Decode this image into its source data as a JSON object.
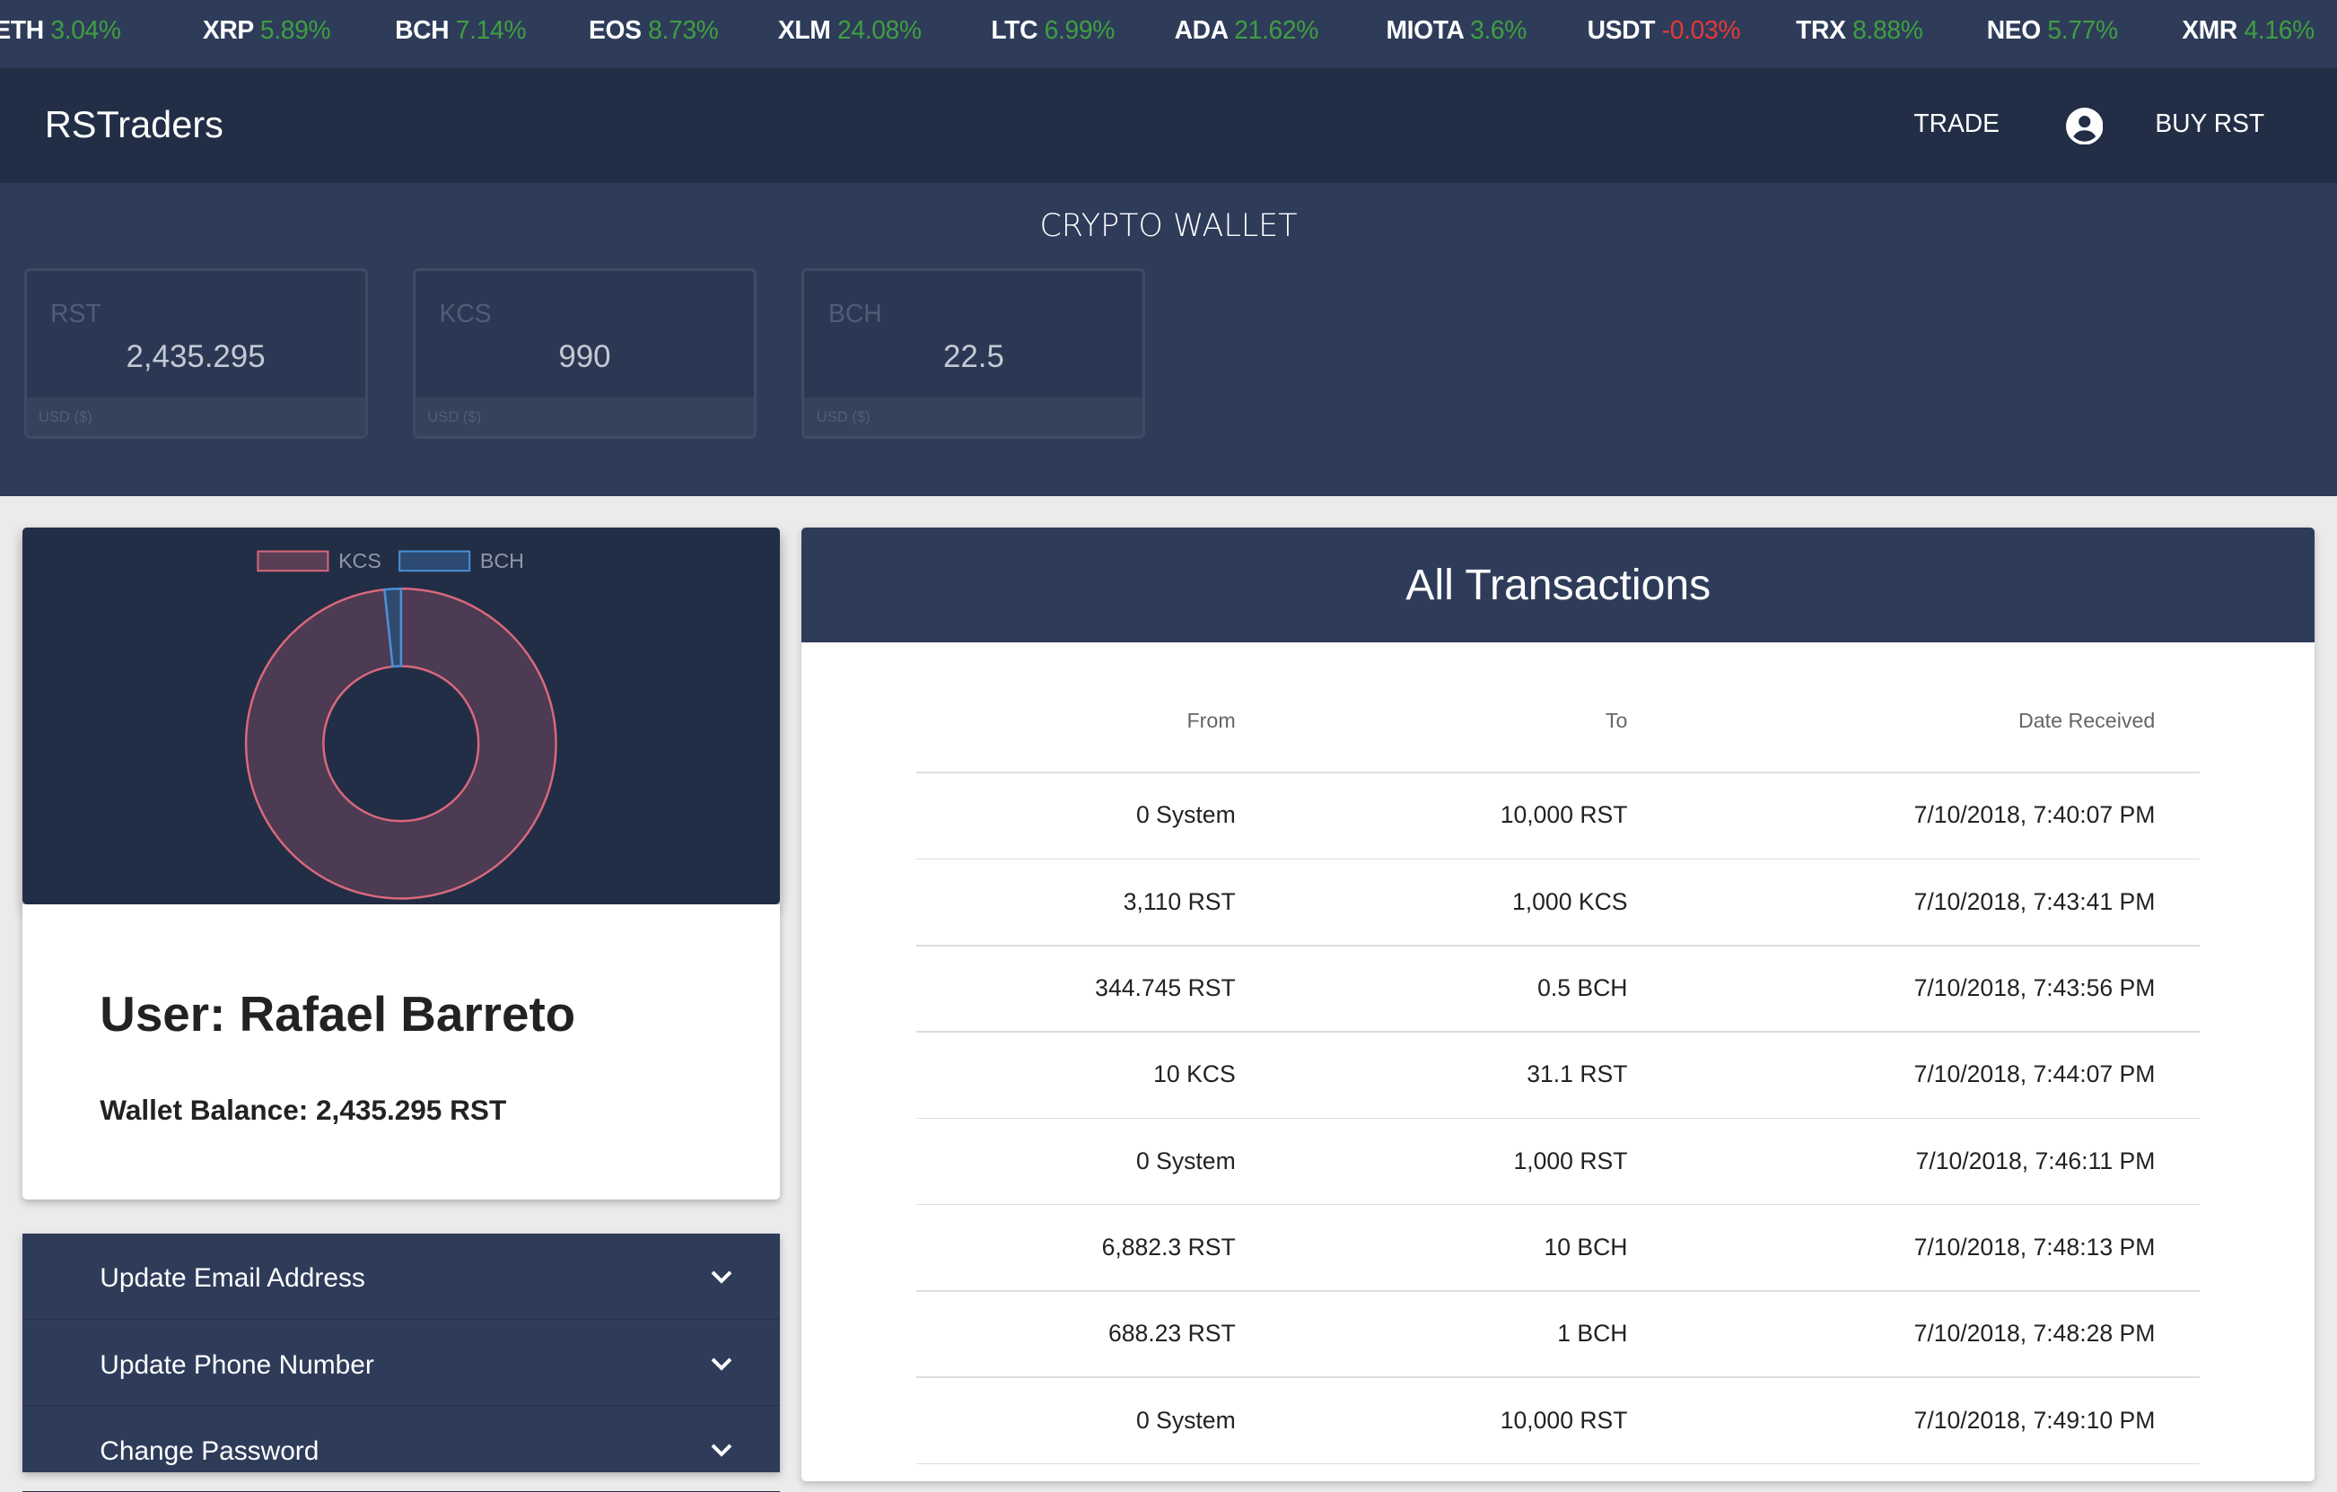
{
  "ticker": [
    {
      "symbol": "ETH",
      "change": "3.04%",
      "color": "#3f9f3f"
    },
    {
      "symbol": "XRP",
      "change": "5.89%",
      "color": "#3f9f3f"
    },
    {
      "symbol": "BCH",
      "change": "7.14%",
      "color": "#3f9f3f"
    },
    {
      "symbol": "EOS",
      "change": "8.73%",
      "color": "#3f9f3f"
    },
    {
      "symbol": "XLM",
      "change": "24.08%",
      "color": "#3f9f3f"
    },
    {
      "symbol": "LTC",
      "change": "6.99%",
      "color": "#3f9f3f"
    },
    {
      "symbol": "ADA",
      "change": "21.62%",
      "color": "#3f9f3f"
    },
    {
      "symbol": "MIOTA",
      "change": "3.6%",
      "color": "#3f9f3f"
    },
    {
      "symbol": "USDT",
      "change": "-0.03%",
      "color": "#e53935"
    },
    {
      "symbol": "TRX",
      "change": "8.88%",
      "color": "#3f9f3f"
    },
    {
      "symbol": "NEO",
      "change": "5.77%",
      "color": "#3f9f3f"
    },
    {
      "symbol": "XMR",
      "change": "4.16%",
      "color": "#3f9f3f"
    }
  ],
  "navbar": {
    "brand": "RSTraders",
    "trade_label": "TRADE",
    "account_icon": "account-circle-icon",
    "buy_label": "BUY RST"
  },
  "wallet": {
    "title": "CRYPTO WALLET",
    "cards": [
      {
        "symbol": "RST",
        "amount": "2,435.295",
        "usd_label": "USD ($)"
      },
      {
        "symbol": "KCS",
        "amount": "990",
        "usd_label": "USD ($)"
      },
      {
        "symbol": "BCH",
        "amount": "22.5",
        "usd_label": "USD ($)"
      }
    ]
  },
  "chart_data": {
    "type": "pie",
    "labels": [
      "KCS",
      "BCH"
    ],
    "values": [
      98.3,
      1.7
    ],
    "colors": [
      "#d9687c",
      "#4a90d9"
    ],
    "legend_position": "top"
  },
  "user": {
    "name": "User: Rafael Barreto",
    "balance": "Wallet Balance: 2,435.295 RST"
  },
  "settings": {
    "items": [
      {
        "label": "Update Email Address",
        "icon": "chevron-down-icon"
      },
      {
        "label": "Update Phone Number",
        "icon": "chevron-down-icon"
      },
      {
        "label": "Change Password",
        "icon": "chevron-down-icon"
      }
    ]
  },
  "transactions": {
    "title": "All Transactions",
    "columns": {
      "from": "From",
      "to": "To",
      "date": "Date Received"
    },
    "rows": [
      {
        "from": "0 System",
        "to": "10,000 RST",
        "date": "7/10/2018, 7:40:07 PM"
      },
      {
        "from": "3,110 RST",
        "to": "1,000 KCS",
        "date": "7/10/2018, 7:43:41 PM"
      },
      {
        "from": "344.745 RST",
        "to": "0.5 BCH",
        "date": "7/10/2018, 7:43:56 PM"
      },
      {
        "from": "10 KCS",
        "to": "31.1 RST",
        "date": "7/10/2018, 7:44:07 PM"
      },
      {
        "from": "0 System",
        "to": "1,000 RST",
        "date": "7/10/2018, 7:46:11 PM"
      },
      {
        "from": "6,882.3 RST",
        "to": "10 BCH",
        "date": "7/10/2018, 7:48:13 PM"
      },
      {
        "from": "688.23 RST",
        "to": "1 BCH",
        "date": "7/10/2018, 7:48:28 PM"
      },
      {
        "from": "0 System",
        "to": "10,000 RST",
        "date": "7/10/2018, 7:49:10 PM"
      }
    ]
  }
}
